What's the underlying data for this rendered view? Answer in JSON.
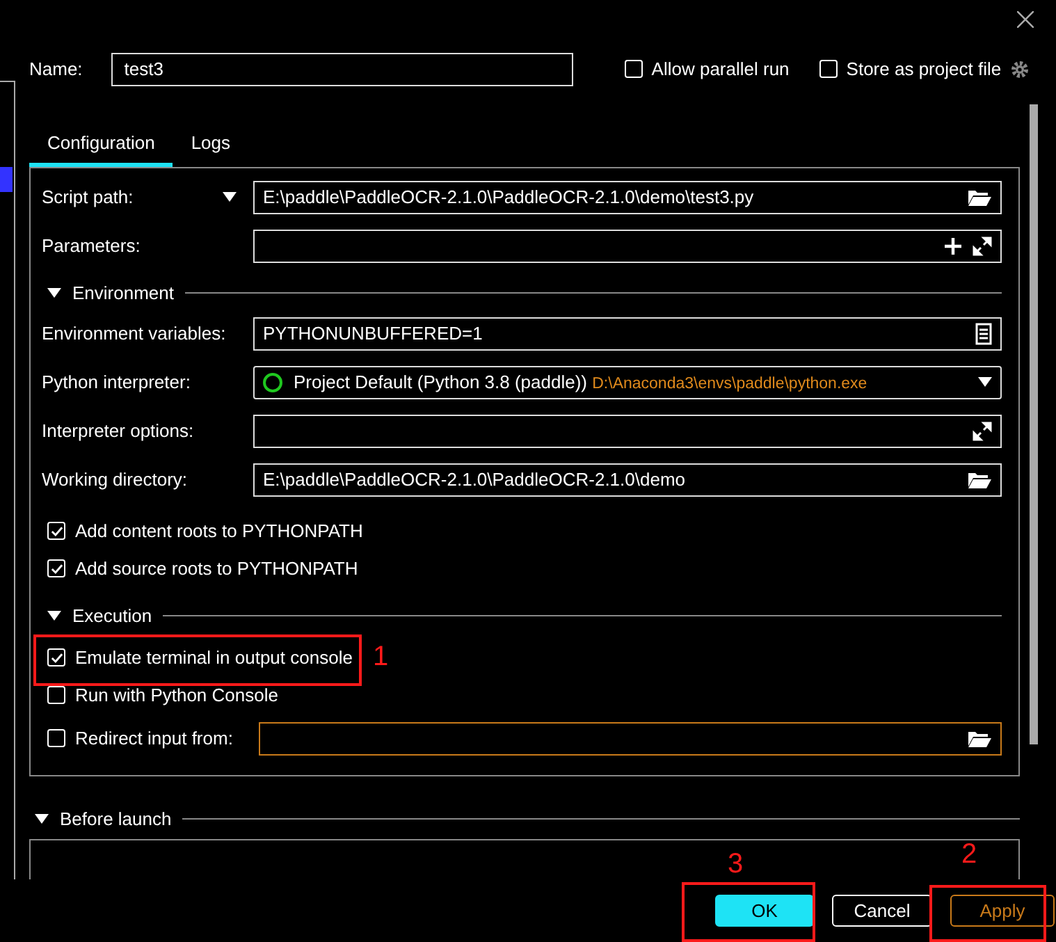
{
  "sidebar": {
    "selected_item": true
  },
  "name": {
    "label": "Name:",
    "value": "test3"
  },
  "header_options": [
    {
      "label": "Allow parallel run",
      "checked": false
    },
    {
      "label": "Store as project file",
      "checked": false,
      "settings": true
    }
  ],
  "tabs": [
    {
      "label": "Configuration",
      "selected": true
    },
    {
      "label": "Logs",
      "selected": false
    }
  ],
  "configuration": [
    {
      "kind": "field",
      "label": "Script path:",
      "dropdown": true,
      "value": "E:\\paddle\\PaddleOCR-2.1.0\\PaddleOCR-2.1.0\\demo\\test3.py",
      "icons": [
        {
          "kind": "browse"
        }
      ]
    },
    {
      "kind": "field",
      "label": "Parameters:",
      "icons": [
        {
          "kind": "add"
        },
        {
          "kind": "expand"
        }
      ]
    },
    {
      "kind": "section",
      "title": "Environment",
      "expanded": true
    },
    {
      "kind": "field",
      "label": "Environment variables:",
      "value": "PYTHONUNBUFFERED=1",
      "icons": [
        {
          "kind": "list"
        }
      ]
    },
    {
      "kind": "interpreter",
      "label": "Python interpreter:",
      "value": "Project Default (Python 3.8 (paddle))",
      "path": "D:\\Anaconda3\\envs\\paddle\\python.exe",
      "icons": [
        {
          "kind": "dropdown"
        }
      ]
    },
    {
      "kind": "field",
      "label": "Interpreter options:",
      "icons": [
        {
          "kind": "expand"
        }
      ]
    },
    {
      "kind": "field",
      "label": "Working directory:",
      "value": "E:\\paddle\\PaddleOCR-2.1.0\\PaddleOCR-2.1.0\\demo",
      "icons": [
        {
          "kind": "browse"
        }
      ]
    },
    {
      "kind": "checkbox",
      "label": "Add content roots to PYTHONPATH",
      "checked": true
    },
    {
      "kind": "checkbox",
      "label": "Add source roots to PYTHONPATH",
      "checked": true
    },
    {
      "kind": "section",
      "title": "Execution",
      "expanded": true
    },
    {
      "kind": "checkbox",
      "label": "Emulate terminal in output console",
      "checked": true
    },
    {
      "kind": "checkbox",
      "label": "Run with Python Console",
      "checked": false
    },
    {
      "kind": "checkbox_field",
      "label": "Redirect input from:",
      "checked": false,
      "icons": [
        {
          "kind": "browse"
        }
      ]
    }
  ],
  "before_launch": {
    "title": "Before launch",
    "expanded": true
  },
  "buttons": [
    {
      "label": "OK",
      "kind": "primary"
    },
    {
      "label": "Cancel",
      "kind": "secondary"
    },
    {
      "label": "Apply",
      "kind": "apply"
    }
  ],
  "annotations": [
    {
      "label": "1"
    },
    {
      "label": "3"
    },
    {
      "label": "2"
    }
  ]
}
